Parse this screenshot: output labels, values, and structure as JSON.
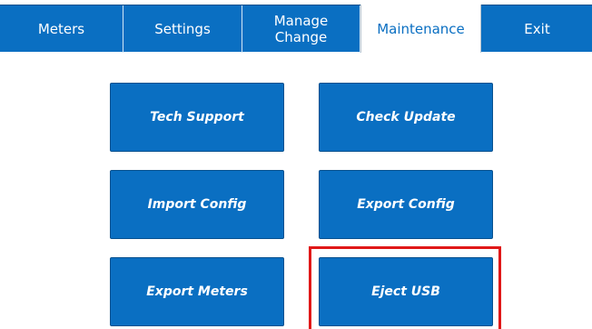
{
  "tabs": {
    "meters": "Meters",
    "settings": "Settings",
    "manage_change": "Manage\nChange",
    "maintenance": "Maintenance",
    "exit": "Exit"
  },
  "actions": {
    "tech_support": "Tech Support",
    "check_update": "Check Update",
    "import_config": "Import Config",
    "export_config": "Export Config",
    "export_meters": "Export Meters",
    "eject_usb": "Eject USB"
  },
  "colors": {
    "primary": "#0a6fc2",
    "highlight": "#e01818",
    "active_tab_text": "#0a6fc2"
  }
}
